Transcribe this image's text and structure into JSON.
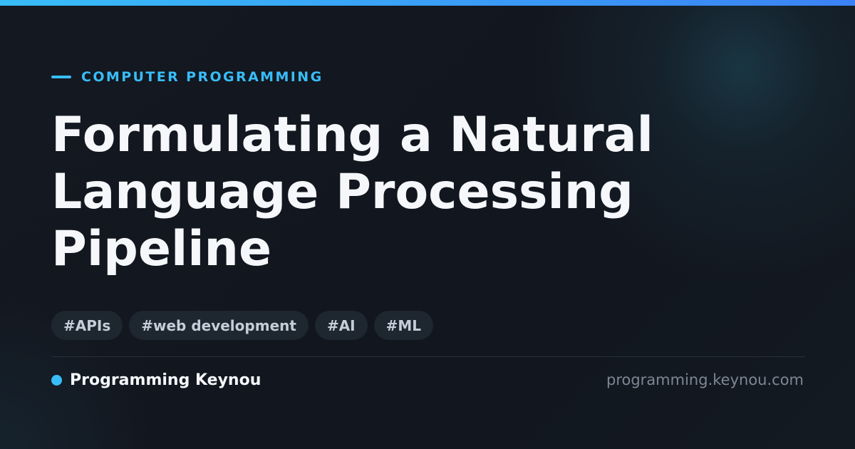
{
  "colors": {
    "accent": "#38bdf8",
    "accent_end": "#3b82f6",
    "background": "#12161e",
    "tag_background": "#1e2630",
    "title_text": "#f5f7fa",
    "muted_text": "#7c8794"
  },
  "header": {
    "category": "COMPUTER PROGRAMMING"
  },
  "title": {
    "line1": "Formulating a Natural",
    "line2": "Language Processing",
    "line3": "Pipeline"
  },
  "tags": [
    "#APIs",
    "#web development",
    "#AI",
    "#ML"
  ],
  "footer": {
    "brand_name": "Programming Keynou",
    "site_url": "programming.keynou.com"
  }
}
